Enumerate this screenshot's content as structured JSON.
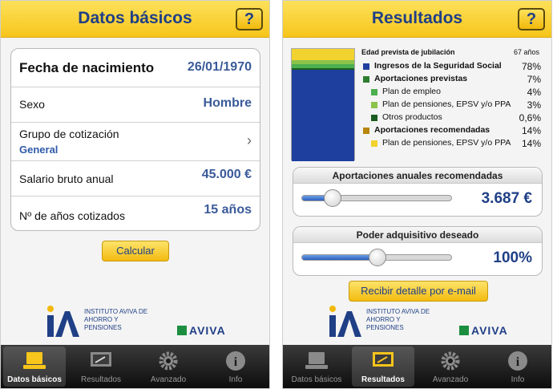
{
  "left": {
    "title": "Datos básicos",
    "help": "?",
    "fields": {
      "fecha_label": "Fecha de nacimiento",
      "fecha_value": "26/01/1970",
      "sexo_label": "Sexo",
      "sexo_value": "Hombre",
      "grupo_label": "Grupo de cotización",
      "grupo_value": "General",
      "salario_label": "Salario bruto anual",
      "salario_value": "45.000 €",
      "anos_label": "Nº de años cotizados",
      "anos_value": "15 años"
    },
    "calcular": "Calcular"
  },
  "right": {
    "title": "Resultados",
    "help": "?",
    "edad_label": "Edad prevista de jubilación",
    "edad_value": "67 años",
    "legend": [
      {
        "label": "Ingresos de la Seguridad Social",
        "value": "78%",
        "color": "#1f3f9e"
      },
      {
        "label": "Aportaciones previstas",
        "value": "7%",
        "color": "#2e7d32"
      },
      {
        "label": "Plan de empleo",
        "value": "4%",
        "color": "#4caf50"
      },
      {
        "label": "Plan de pensiones, EPSV y/o PPA",
        "value": "3%",
        "color": "#8bc34a"
      },
      {
        "label": "Otros productos",
        "value": "0,6%",
        "color": "#1b5e20"
      },
      {
        "label": "Aportaciones recomendadas",
        "value": "14%",
        "color": "#b8860b"
      },
      {
        "label": "Plan de pensiones, EPSV y/o PPA",
        "value": "14%",
        "color": "#f2d22e"
      }
    ],
    "aportaciones_title": "Aportaciones anuales recomendadas",
    "aportaciones_value": "3.687 €",
    "aportaciones_level": 0.2,
    "poder_title": "Poder adquisitivo deseado",
    "poder_value": "100%",
    "poder_level": 0.5,
    "email_btn": "Recibir detalle por e-mail"
  },
  "brand": {
    "institute": "INSTITUTO AVIVA DE AHORRO Y PENSIONES",
    "aviva": "AVIVA"
  },
  "tabs": [
    "Datos básicos",
    "Resultados",
    "Avanzado",
    "Info"
  ],
  "colors": {
    "header": "#f7c51b",
    "title_text": "#1f3f86",
    "accent": "#1f3f86"
  }
}
